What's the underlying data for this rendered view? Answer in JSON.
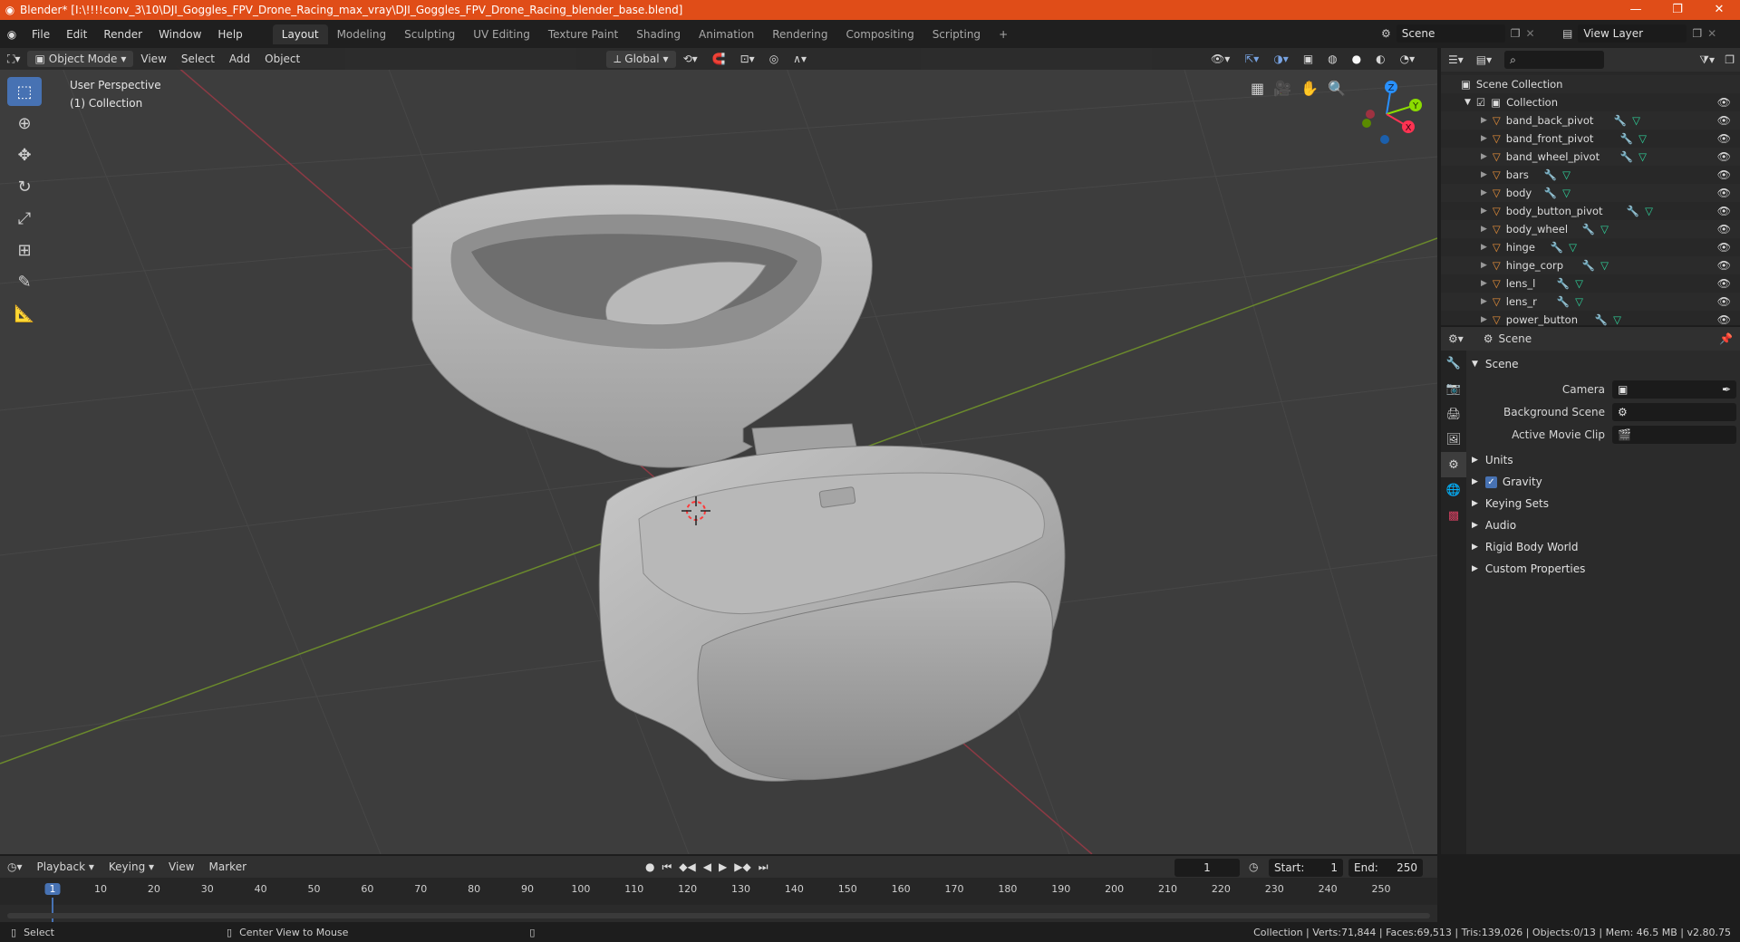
{
  "title": {
    "text": "Blender* [I:\\!!!!conv_3\\10\\DJI_Goggles_FPV_Drone_Racing_max_vray\\DJI_Goggles_FPV_Drone_Racing_blender_base.blend]",
    "minimize": "—",
    "restore": "❐",
    "close": "✕"
  },
  "menu": {
    "items": [
      "File",
      "Edit",
      "Render",
      "Window",
      "Help"
    ],
    "workspaces": [
      "Layout",
      "Modeling",
      "Sculpting",
      "UV Editing",
      "Texture Paint",
      "Shading",
      "Animation",
      "Rendering",
      "Compositing",
      "Scripting"
    ],
    "add_workspace": "+",
    "scene": "Scene",
    "view_layer": "View Layer"
  },
  "viewport": {
    "mode": "Object Mode",
    "menus": [
      "View",
      "Select",
      "Add",
      "Object"
    ],
    "orientation": "Global",
    "perspective_label": "User Perspective",
    "collection_label": "(1) Collection",
    "axes": {
      "x": "X",
      "y": "Y",
      "z": "Z"
    }
  },
  "outliner": {
    "root": "Scene Collection",
    "collection": "Collection",
    "objects": [
      "band_back_pivot",
      "band_front_pivot",
      "band_wheel_pivot",
      "bars",
      "body",
      "body_button_pivot",
      "body_wheel",
      "hinge",
      "hinge_corp",
      "lens_l",
      "lens_r",
      "power_button"
    ]
  },
  "properties": {
    "header": "Scene",
    "section": "Scene",
    "fields": [
      {
        "label": "Camera",
        "value": ""
      },
      {
        "label": "Background Scene",
        "value": ""
      },
      {
        "label": "Active Movie Clip",
        "value": ""
      }
    ],
    "panels": [
      "Units",
      "Gravity",
      "Keying Sets",
      "Audio",
      "Rigid Body World",
      "Custom Properties"
    ],
    "gravity_checked": true
  },
  "timeline": {
    "menus": [
      "Playback",
      "Keying",
      "View",
      "Marker"
    ],
    "current_frame": "1",
    "start_label": "Start:",
    "start": "1",
    "end_label": "End:",
    "end": "250",
    "ticks": [
      "1",
      "10",
      "20",
      "30",
      "40",
      "50",
      "60",
      "70",
      "80",
      "90",
      "100",
      "110",
      "120",
      "130",
      "140",
      "150",
      "160",
      "170",
      "180",
      "190",
      "200",
      "210",
      "220",
      "230",
      "240",
      "250"
    ]
  },
  "status": {
    "left1": "Select",
    "left2": "Center View to Mouse",
    "right": "Collection | Verts:71,844 | Faces:69,513 | Tris:139,026 | Objects:0/13 | Mem: 46.5 MB | v2.80.75"
  },
  "colors": {
    "accent": "#4772b3",
    "titlebar": "#e04d18",
    "object_icon": "#e8903a",
    "mesh_icon": "#2fd39b",
    "axis_x": "#ff3352",
    "axis_y": "#8bdc00",
    "axis_z": "#2890ff"
  }
}
